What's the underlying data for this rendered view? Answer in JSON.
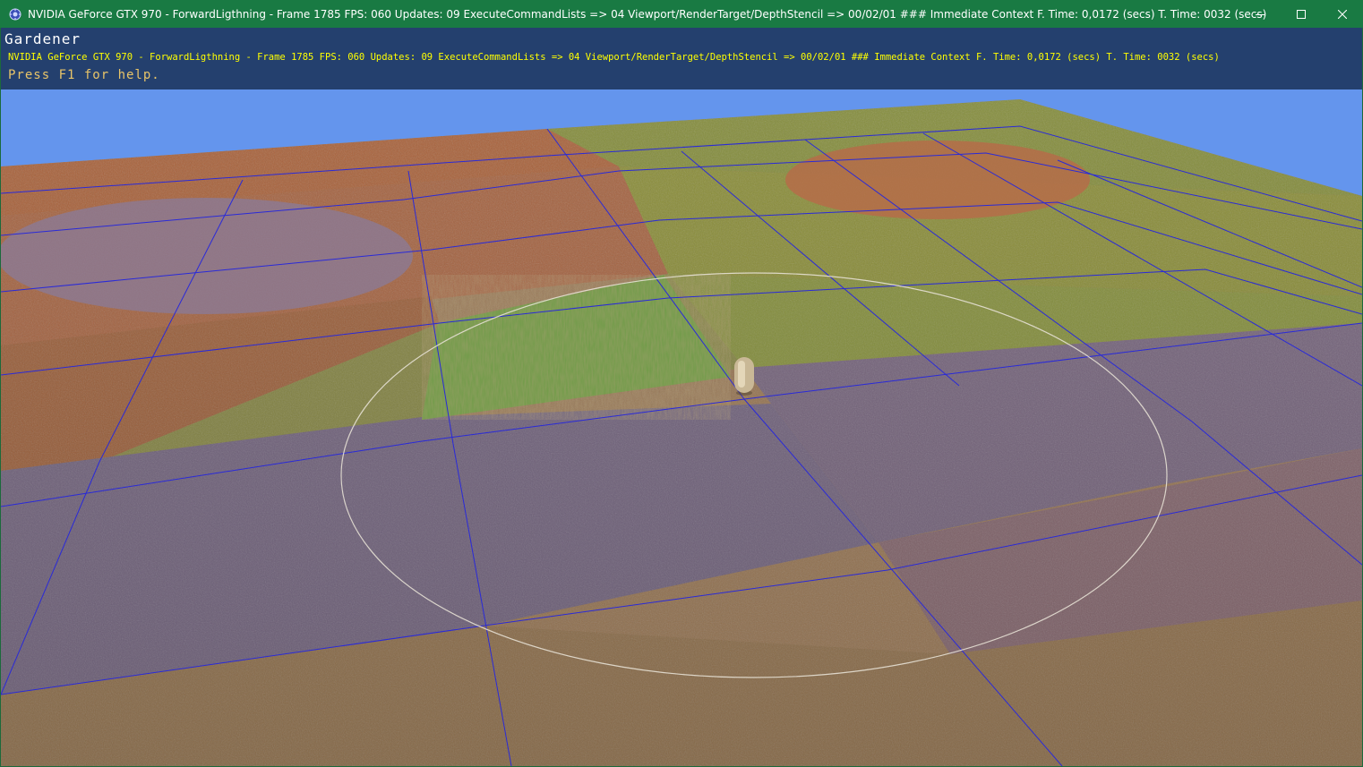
{
  "window": {
    "title": "NVIDIA GeForce GTX 970 - ForwardLigthning - Frame 1785 FPS: 060 Updates: 09 ExecuteCommandLists => 04 Viewport/RenderTarget/DepthStencil => 00/02/01 ### Immediate Context F. Time: 0,0172 (secs) T. Time: 0032 (secs)",
    "icon": "app-gear-icon",
    "controls": [
      "minimize-icon",
      "maximize-icon",
      "close-icon"
    ]
  },
  "overlay": {
    "app_name": "Gardener",
    "stats": "NVIDIA GeForce GTX 970 - ForwardLigthning - Frame 1785 FPS: 060 Updates: 09 ExecuteCommandLists => 04 Viewport/RenderTarget/DepthStencil => 00/02/01 ### Immediate Context F. Time: 0,0172 (secs) T. Time: 0032 (secs)",
    "help": "Press F1 for help."
  },
  "colors": {
    "titlebar": "#197a43",
    "hud_background": "#24406e",
    "sky": "#6495ed",
    "grid_lines": "#2a2ad8",
    "stats_text": "#ffff00",
    "help_text": "#e8c468"
  },
  "scene": {
    "terrain_tiles": [
      {
        "name": "tile-clay",
        "color": "#b46a45"
      },
      {
        "name": "tile-moss",
        "color": "#8f9a3e"
      },
      {
        "name": "tile-rock",
        "color": "#7d6b86"
      },
      {
        "name": "tile-soil",
        "color": "#a07a52"
      },
      {
        "name": "tile-grass",
        "color": "#6b9a45"
      }
    ],
    "objects": [
      "brush-radius-ring",
      "capsule-marker",
      "grass-patch",
      "clay-circle-patch",
      "rock-circle-patch"
    ]
  }
}
